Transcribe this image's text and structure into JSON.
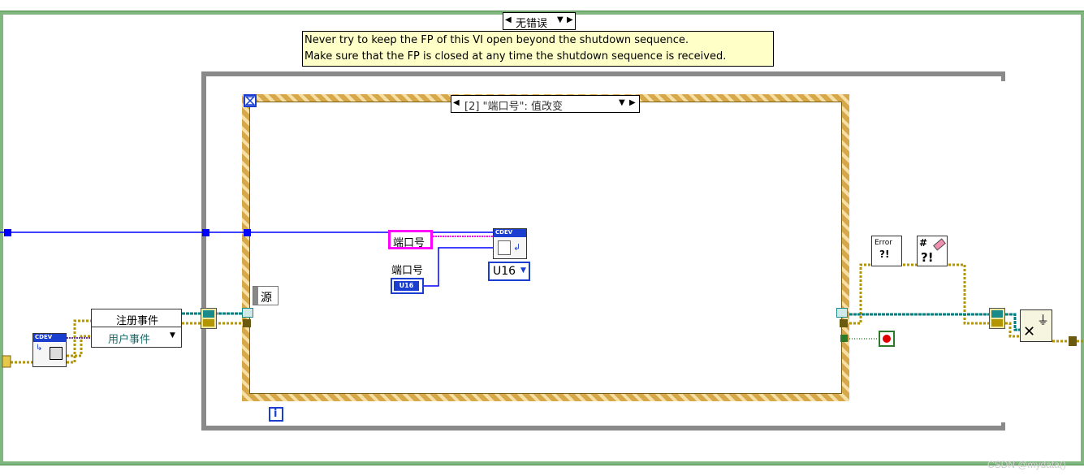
{
  "case_structure": {
    "selector_label": "无错误",
    "selector_arrows": "◂▾▸"
  },
  "comment": {
    "line1": "Never try to keep the FP of this VI open beyond the shutdown sequence.",
    "line2": "Make sure that the FP is closed at any time the shutdown sequence is received."
  },
  "event_structure": {
    "selector_label": "[2] \"端口号\": 值改变",
    "timeout_icon": "hourglass-icon",
    "source_label": "源",
    "iteration_label": "i"
  },
  "controls": {
    "port_local_var": "端口号",
    "port_terminal_label": "端口号",
    "port_terminal_type": "U16",
    "u16_constant": "U16"
  },
  "register_events": {
    "title": "注册事件",
    "input": "用户事件"
  },
  "subvi": {
    "vendor_tag": "CDEV",
    "error_node_text": "Error",
    "qmark": "?!",
    "clear_errors_hash": "#"
  },
  "watermark": "CSDN @mydata()",
  "colors": {
    "wire_blue": "#0000ff",
    "wire_error": "#b39500",
    "wire_event": "#007f7f",
    "wire_pink": "#ff00ff",
    "structure_gray": "#8a8a8a",
    "case_green": "#5aa05a"
  }
}
